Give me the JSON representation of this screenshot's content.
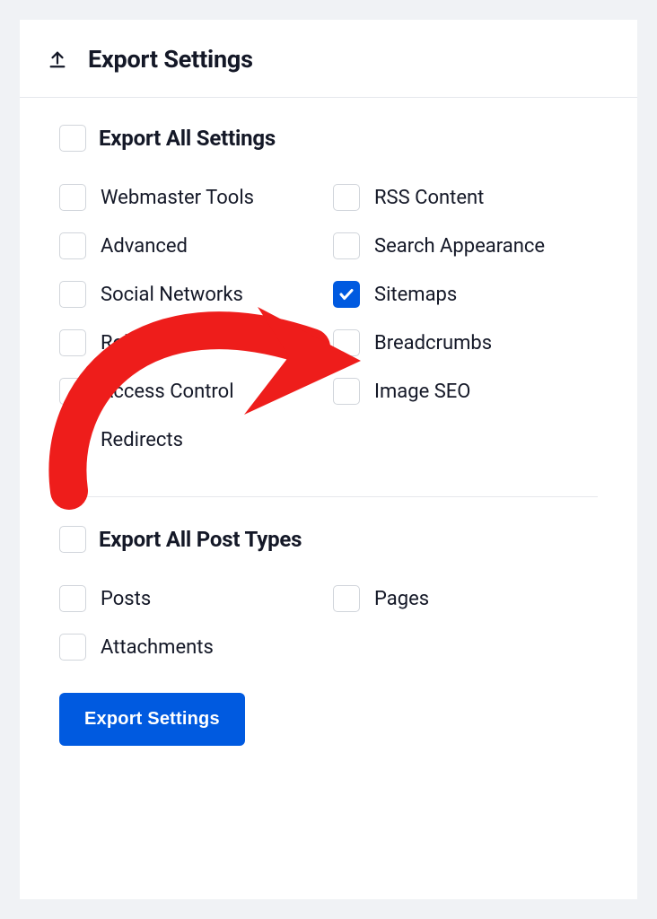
{
  "header": {
    "title": "Export Settings"
  },
  "sections": {
    "settings": {
      "heading": "Export All Settings",
      "items": [
        {
          "label": "Webmaster Tools",
          "checked": false
        },
        {
          "label": "RSS Content",
          "checked": false
        },
        {
          "label": "Advanced",
          "checked": false
        },
        {
          "label": "Search Appearance",
          "checked": false
        },
        {
          "label": "Social Networks",
          "checked": false
        },
        {
          "label": "Sitemaps",
          "checked": true
        },
        {
          "label": "Robots.txt",
          "checked": false
        },
        {
          "label": "Breadcrumbs",
          "checked": false
        },
        {
          "label": "Access Control",
          "checked": false
        },
        {
          "label": "Image SEO",
          "checked": false
        },
        {
          "label": "Redirects",
          "checked": false
        }
      ]
    },
    "post_types": {
      "heading": "Export All Post Types",
      "items": [
        {
          "label": "Posts",
          "checked": false
        },
        {
          "label": "Pages",
          "checked": false
        },
        {
          "label": "Attachments",
          "checked": false
        }
      ]
    }
  },
  "button": {
    "label": "Export Settings"
  },
  "colors": {
    "accent": "#005ae0",
    "text": "#141827",
    "border": "#d1d5db",
    "annotation": "#ee1d1b"
  }
}
